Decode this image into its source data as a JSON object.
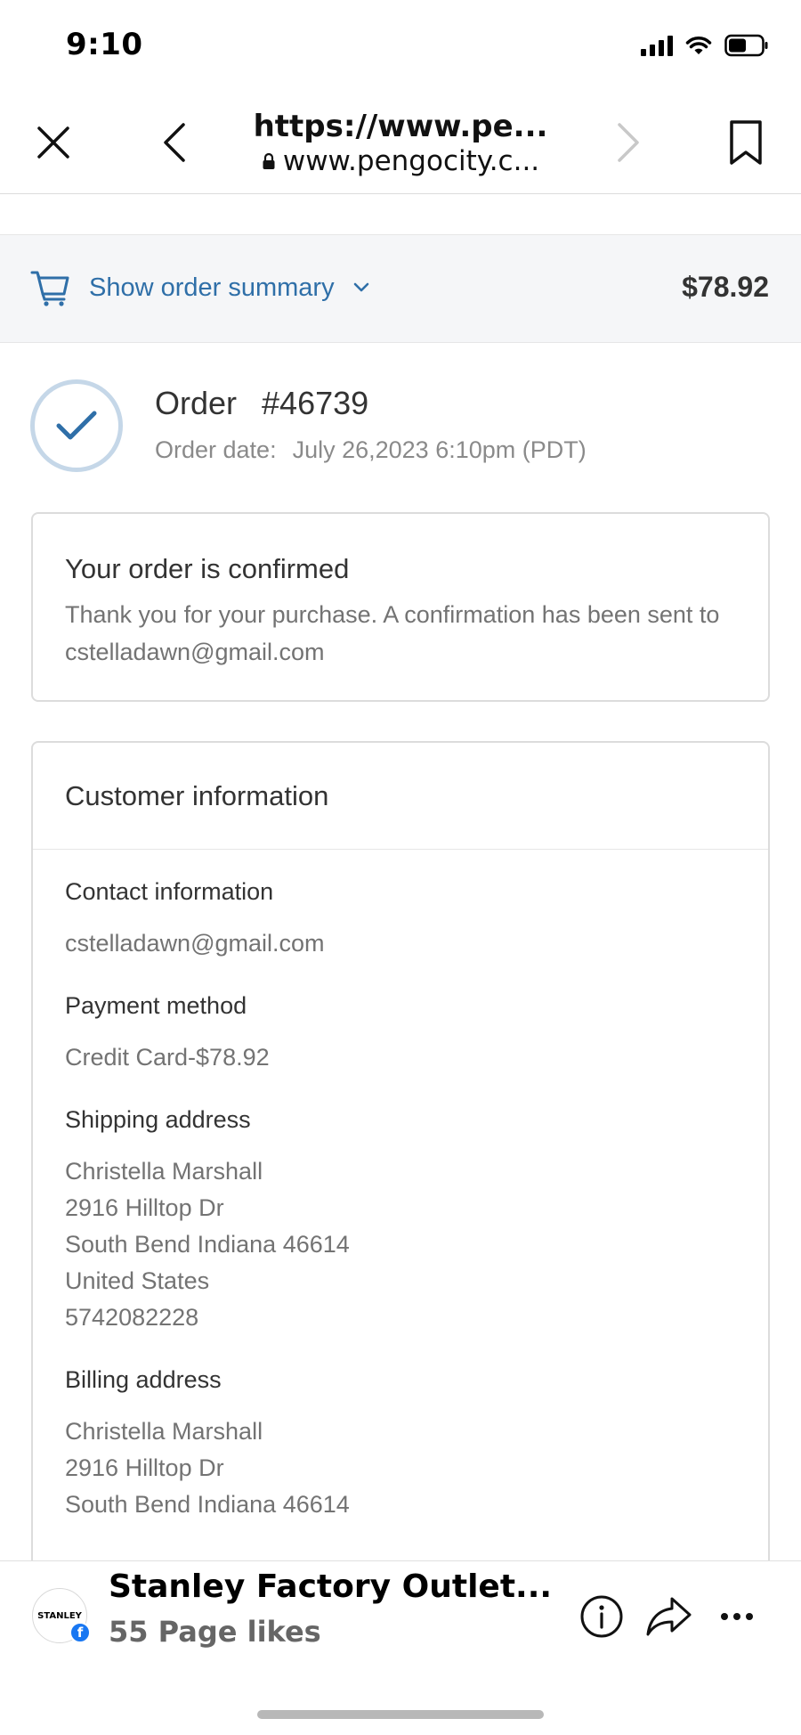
{
  "status_bar": {
    "time": "9:10",
    "icons": [
      "signal-icon",
      "wifi-icon",
      "battery-icon"
    ],
    "battery_level": 0.55
  },
  "browser": {
    "title": "https://www.pe...",
    "domain": "www.pengocity.c...",
    "icons": [
      "close-icon",
      "back-icon",
      "lock-icon",
      "forward-icon",
      "bookmark-icon"
    ]
  },
  "summary": {
    "label": "Show order summary",
    "total": "$78.92",
    "icons": [
      "cart-icon",
      "chevron-down-icon"
    ]
  },
  "order": {
    "label": "Order",
    "number": "#46739",
    "date_label": "Order date:",
    "date_value": "July 26,2023 6:10pm (PDT)"
  },
  "confirmation": {
    "title": "Your order is confirmed",
    "text": "Thank you for your purchase. A confirmation has been sent to cstelladawn@gmail.com"
  },
  "customer": {
    "title": "Customer information",
    "contact": {
      "label": "Contact information",
      "email": "cstelladawn@gmail.com"
    },
    "payment": {
      "label": "Payment method",
      "value": "Credit Card-$78.92"
    },
    "shipping": {
      "label": "Shipping address",
      "lines": [
        "Christella Marshall",
        "2916 Hilltop Dr",
        "South Bend Indiana 46614",
        "United States",
        "5742082228"
      ]
    },
    "billing": {
      "label": "Billing address",
      "lines": [
        "Christella Marshall",
        "2916 Hilltop Dr",
        "South Bend Indiana 46614"
      ]
    }
  },
  "bottom_sheet": {
    "page_name": "Stanley Factory Outlet...",
    "page_likes": "55 Page likes",
    "avatar_text": "STANLEY",
    "badge": "f",
    "icons": [
      "info-icon",
      "share-icon",
      "more-icon"
    ]
  },
  "colors": {
    "link_blue": "#2f6fa8",
    "check_blue": "#2f6fa8",
    "muted_text": "#737373",
    "facebook_blue": "#1877f2"
  }
}
